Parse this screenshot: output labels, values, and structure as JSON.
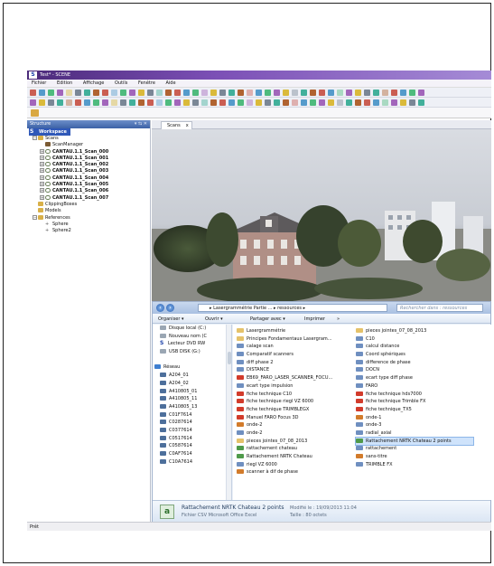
{
  "window": {
    "title": "Test* - SCENE"
  },
  "menu": [
    "Fichier",
    "Edition",
    "Affichage",
    "Outils",
    "Fenêtre",
    "Aide"
  ],
  "structure": {
    "panel_title": "Structure",
    "panel_controls": "▾ ⇆ ✕",
    "workspace": "Workspace",
    "items": [
      {
        "label": "Scans",
        "level": 1,
        "icon": "folder",
        "bold": false,
        "expander": "−"
      },
      {
        "label": "ScanManager",
        "level": 2,
        "icon": "mgr",
        "bold": false,
        "expander": ""
      },
      {
        "label": "CANTAU.1.1_Scan_000",
        "level": 2,
        "icon": "scan",
        "bold": true,
        "expander": "+"
      },
      {
        "label": "CANTAU.1.1_Scan_001",
        "level": 2,
        "icon": "scan",
        "bold": true,
        "expander": "+"
      },
      {
        "label": "CANTAU.1.1_Scan_002",
        "level": 2,
        "icon": "scan",
        "bold": true,
        "expander": "+"
      },
      {
        "label": "CANTAU.1.1_Scan_003",
        "level": 2,
        "icon": "scan",
        "bold": true,
        "expander": "+"
      },
      {
        "label": "CANTAU.1.1_Scan_004",
        "level": 2,
        "icon": "scan",
        "bold": true,
        "expander": "+"
      },
      {
        "label": "CANTAU.1.1_Scan_005",
        "level": 2,
        "icon": "scan",
        "bold": true,
        "expander": "+"
      },
      {
        "label": "CANTAU.1.1_Scan_006",
        "level": 2,
        "icon": "scan",
        "bold": true,
        "expander": "+"
      },
      {
        "label": "CANTAU.1.1_Scan_007",
        "level": 2,
        "icon": "scan",
        "bold": true,
        "expander": "+"
      },
      {
        "label": "ClippingBoxes",
        "level": 1,
        "icon": "folder",
        "bold": false,
        "expander": ""
      },
      {
        "label": "Models",
        "level": 1,
        "icon": "folder",
        "bold": false,
        "expander": ""
      },
      {
        "label": "References",
        "level": 1,
        "icon": "folder",
        "bold": false,
        "expander": "−"
      },
      {
        "label": "Sphere",
        "level": 2,
        "icon": "sphere",
        "bold": false,
        "expander": ""
      },
      {
        "label": "Sphere2",
        "level": 2,
        "icon": "sphere",
        "bold": false,
        "expander": ""
      }
    ]
  },
  "scans_tab": {
    "label": "Scans",
    "close": "x"
  },
  "explorer": {
    "path": "▸ Lasergrammétrie Partie ... ▸ ressources ▸",
    "search_placeholder": "Rechercher dans : ressources",
    "commands": {
      "organize": "Organiser ▾",
      "open": "Ouvrir ▾",
      "share": "Partager avec ▾",
      "print": "Imprimer",
      "more": "»"
    },
    "nav": [
      {
        "label": "Disque local (C:)",
        "icon": "drv"
      },
      {
        "label": "Nouveau nom (C",
        "icon": "drv"
      },
      {
        "label": "Lecteur DVD RW",
        "icon": "s"
      },
      {
        "label": "USB DISK (G:)",
        "icon": "drv"
      },
      {
        "label": "",
        "icon": ""
      },
      {
        "label": "Réseau",
        "icon": "net"
      },
      {
        "label": "A204_01",
        "icon": "pc"
      },
      {
        "label": "A204_02",
        "icon": "pc"
      },
      {
        "label": "A410805_01",
        "icon": "pc"
      },
      {
        "label": "A410805_11",
        "icon": "pc"
      },
      {
        "label": "A410805_13",
        "icon": "pc"
      },
      {
        "label": "C01F7614",
        "icon": "pc"
      },
      {
        "label": "C0287614",
        "icon": "pc"
      },
      {
        "label": "C0377614",
        "icon": "pc"
      },
      {
        "label": "C0517614",
        "icon": "pc"
      },
      {
        "label": "C0587614",
        "icon": "pc"
      },
      {
        "label": "C0AF7614",
        "icon": "pc"
      },
      {
        "label": "C10A7614",
        "icon": "pc"
      }
    ],
    "files_col1": [
      {
        "label": "Lasergrammétrie",
        "icon": "folder"
      },
      {
        "label": "Principes Fondamentaux Lasergram...",
        "icon": "folder"
      },
      {
        "label": "calage scan",
        "icon": "doc"
      },
      {
        "label": "Comparatif scanners",
        "icon": "doc"
      },
      {
        "label": "diff phase 2",
        "icon": "doc"
      },
      {
        "label": "DISTANCE",
        "icon": "doc"
      },
      {
        "label": "EB69_FARO_LASER_SCANNER_FOCU...",
        "icon": "pdf"
      },
      {
        "label": "ecart type impulsion",
        "icon": "doc"
      },
      {
        "label": "fiche technique C10",
        "icon": "pdf"
      },
      {
        "label": "fiche technique riegl VZ 6000",
        "icon": "pdf"
      },
      {
        "label": "fiche technique TRIMBLEGX",
        "icon": "pdf"
      },
      {
        "label": "Manuel FARO Focus 3D",
        "icon": "pdf"
      },
      {
        "label": "onde-2",
        "icon": "img"
      },
      {
        "label": "onde-2",
        "icon": "doc"
      },
      {
        "label": "pieces jointes_07_08_2013",
        "icon": "folder"
      },
      {
        "label": "rattachement chateau",
        "icon": "xls"
      },
      {
        "label": "Rattachement NRTK Chateau",
        "icon": "xls"
      },
      {
        "label": "riegl VZ 6000",
        "icon": "doc"
      },
      {
        "label": "scanner à dif de phase",
        "icon": "img"
      }
    ],
    "files_col2": [
      {
        "label": "pieces jointes_07_08_2013",
        "icon": "folder"
      },
      {
        "label": "C10",
        "icon": "doc"
      },
      {
        "label": "calcul distance",
        "icon": "doc"
      },
      {
        "label": "Coord sphériques",
        "icon": "doc"
      },
      {
        "label": "difference de phase",
        "icon": "doc"
      },
      {
        "label": "DOCN",
        "icon": "doc"
      },
      {
        "label": "ecart type diff phase",
        "icon": "doc"
      },
      {
        "label": "FARO",
        "icon": "doc"
      },
      {
        "label": "fiche technique hds7000",
        "icon": "pdf"
      },
      {
        "label": "fiche technique Trimble FX",
        "icon": "pdf"
      },
      {
        "label": "fiche technique_TX5",
        "icon": "pdf"
      },
      {
        "label": "onde-1",
        "icon": "img"
      },
      {
        "label": "onde-3",
        "icon": "doc"
      },
      {
        "label": "radial_axial",
        "icon": "doc"
      },
      {
        "label": "Rattachement NRTK Chateau 2 points",
        "icon": "xls",
        "selected": true
      },
      {
        "label": "rattachement",
        "icon": "doc"
      },
      {
        "label": "sans-titre",
        "icon": "img"
      },
      {
        "label": "TRIMBLE FX",
        "icon": "doc"
      }
    ],
    "details": {
      "name": "Rattachement NRTK Chateau 2 points",
      "type": "Fichier CSV Microsoft Office Excel",
      "modified": "Modifié le : 19/09/2013 11:04",
      "size": "Taille : 80 octets"
    }
  },
  "status": "Prêt",
  "colors": {
    "title_bar": "#4b2a7a",
    "accent": "#2f58b8",
    "selection": "#cfe3fb"
  }
}
